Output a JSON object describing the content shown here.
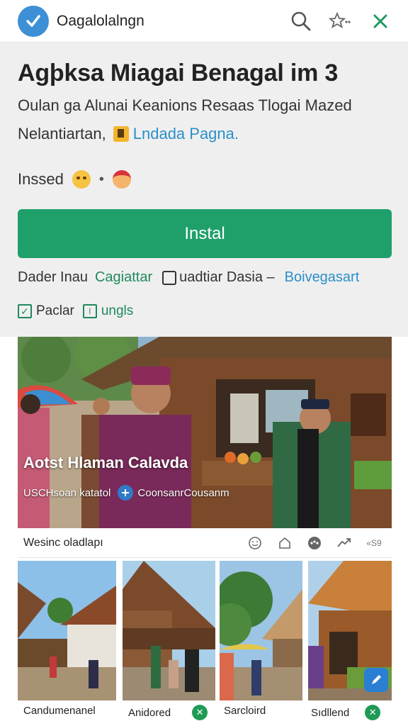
{
  "topbar": {
    "app_name": "Oagalolalngn",
    "icons": [
      "verified-logo-icon",
      "search-icon",
      "star-rate-icon",
      "close-icon"
    ]
  },
  "hero": {
    "title": "Agþksa Miagai Benagal im 3",
    "description_line1": "Oulan ga Alunai Keanions Resaas Tlogai Mazed",
    "description_line2_text": "Nelantiartan,",
    "description_line2_link": "Lndada Pagna.",
    "rating_label": "Inssed",
    "rating_separator": "•"
  },
  "install_button": {
    "label": "Instal",
    "color": "#1fa06a"
  },
  "meta": {
    "developer": "Dader Inau",
    "category": "Cagiattar",
    "checkbox_label": "uadtiar Dasia –",
    "link": "Boivegasart"
  },
  "tags": {
    "tag1": "Paclar",
    "tag2": "ungls"
  },
  "screenshot": {
    "overlay_title": "Aotst Hlaman Calavda",
    "overlay_sub_left": "USCHsoan katatol",
    "overlay_sub_right": "CoonsanrCousanm"
  },
  "toolbar": {
    "label": "Wesinc oladlapı",
    "icons": [
      "smile-icon",
      "home-outline-icon",
      "dots-circle-icon",
      "share-arrow-icon",
      "more-text-icon"
    ],
    "more_label": "«S9"
  },
  "thumbnails": [
    {
      "label": "Candumenanel",
      "has_badge": false
    },
    {
      "label": "Anidored",
      "has_badge": true,
      "badge": "✕"
    },
    {
      "label": "Sarcloird",
      "has_badge": false
    },
    {
      "label": "Sıdllend",
      "has_badge": true,
      "badge": "✕"
    }
  ],
  "colors": {
    "accent_green": "#1fa06a",
    "link_blue": "#2b8fc8",
    "hero_bg": "#efeff0"
  }
}
